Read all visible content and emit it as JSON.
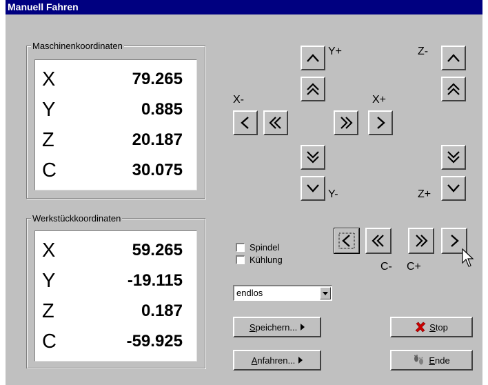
{
  "window": {
    "title": "Manuell Fahren"
  },
  "machine": {
    "legend": "Maschinenkoordinaten",
    "rows": [
      {
        "axis": "X",
        "value": "79.265"
      },
      {
        "axis": "Y",
        "value": "0.885"
      },
      {
        "axis": "Z",
        "value": "20.187"
      },
      {
        "axis": "C",
        "value": "30.075"
      }
    ]
  },
  "workpiece": {
    "legend": "Werkstückkoordinaten",
    "rows": [
      {
        "axis": "X",
        "value": "59.265"
      },
      {
        "axis": "Y",
        "value": "-19.115"
      },
      {
        "axis": "Z",
        "value": "0.187"
      },
      {
        "axis": "C",
        "value": "-59.925"
      }
    ]
  },
  "jog_labels": {
    "y_plus": "Y+",
    "y_minus": "Y-",
    "x_minus": "X-",
    "x_plus": "X+",
    "z_minus": "Z-",
    "z_plus": "Z+",
    "c_minus": "C-",
    "c_plus": "C+"
  },
  "options": {
    "spindle_label": "Spindel",
    "spindle_checked": false,
    "cooling_label": "Kühlung",
    "cooling_checked": false
  },
  "mode_select": {
    "value": "endlos"
  },
  "buttons": {
    "save": {
      "mnemonic": "S",
      "rest": "peichern..."
    },
    "approach": {
      "mnemonic": "A",
      "rest": "nfahren..."
    },
    "stop": {
      "mnemonic": "S",
      "rest": "top"
    },
    "end": {
      "mnemonic": "E",
      "rest": "nde"
    }
  },
  "icons": {
    "jog_step": "single-chevron",
    "jog_fast": "double-chevron",
    "dropdown": "triangle-down",
    "stop": "red-x-icon",
    "end": "footprints-icon",
    "menu_arrow": "triangle-right"
  },
  "colors": {
    "title_bg": "#000080",
    "face": "#c0c0c0",
    "stop_red": "#cc0000"
  }
}
